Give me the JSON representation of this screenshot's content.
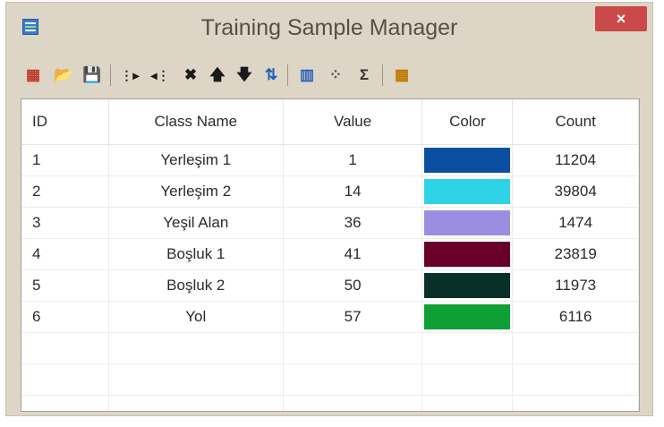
{
  "window": {
    "title": "Training Sample Manager",
    "close_label": "×"
  },
  "toolbar": {
    "buttons": [
      {
        "name": "merge-classes-icon",
        "glyph": "▦"
      },
      {
        "name": "open-folder-icon",
        "glyph": "📂"
      },
      {
        "name": "save-icon",
        "glyph": "💾"
      },
      {
        "name": "insert-after-icon",
        "glyph": "⋮▸"
      },
      {
        "name": "insert-before-icon",
        "glyph": "◂⋮"
      },
      {
        "name": "delete-icon",
        "glyph": "✖"
      },
      {
        "name": "move-up-icon",
        "glyph": "🡅"
      },
      {
        "name": "move-down-icon",
        "glyph": "🡇"
      },
      {
        "name": "sort-icon",
        "glyph": "⇅"
      },
      {
        "name": "histogram-icon",
        "glyph": "▥"
      },
      {
        "name": "scatterplot-icon",
        "glyph": "⁘"
      },
      {
        "name": "statistics-icon",
        "glyph": "Σ"
      },
      {
        "name": "color-palette-icon",
        "glyph": "▩"
      }
    ]
  },
  "table": {
    "headers": {
      "id": "ID",
      "name": "Class Name",
      "value": "Value",
      "color": "Color",
      "count": "Count"
    },
    "rows": [
      {
        "id": "1",
        "name": "Yerleşim 1",
        "value": "1",
        "color": "#0c4fa0",
        "count": "11204"
      },
      {
        "id": "2",
        "name": "Yerleşim 2",
        "value": "14",
        "color": "#2fd3e6",
        "count": "39804"
      },
      {
        "id": "3",
        "name": "Yeşil Alan",
        "value": "36",
        "color": "#9b8ee0",
        "count": "1474"
      },
      {
        "id": "4",
        "name": "Boşluk 1",
        "value": "41",
        "color": "#680028",
        "count": "23819"
      },
      {
        "id": "5",
        "name": "Boşluk 2",
        "value": "50",
        "color": "#083028",
        "count": "11973"
      },
      {
        "id": "6",
        "name": "Yol",
        "value": "57",
        "color": "#0ea034",
        "count": "6116"
      }
    ]
  }
}
